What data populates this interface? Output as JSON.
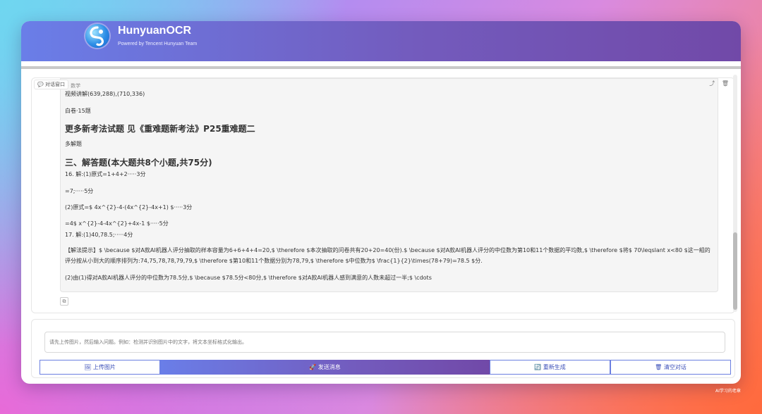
{
  "app": {
    "title": "HunyuanOCR",
    "subtitle": "Powered by Tencent Hunyuan Team"
  },
  "chat": {
    "label": "💬 对话窗口",
    "share_icon": "share-icon",
    "delete_icon": "trash-icon",
    "lines": [
      "视频讲解(639,288),(710,336)",
      "白卷·15题",
      "更多新考法试题 见《重难题新考法》P25重难题二",
      "多解题",
      "三、解答题(本大题共8个小题,共75分)",
      "16. 解:(1)原式=1+4+2·····3分",
      "=7;·····5分",
      "(2)原式=$ 4x^{2}-4-(4x^{2}-4x+1) $·····3分",
      "=4$ x^{2}-4-4x^{2}+4x-1 $·····5分",
      "17. 解:(1)40,78.5;·····4分",
      "【解法提示】$ \\because $对A款AI机器人评分抽取的样本容量为6+6+4+4=20,$ \\therefore $本次抽取的问卷共有20+20=40(份).$ \\because $对A款AI机器人评分的中位数为第10和11个数据的平均数,$ \\therefore $将$ 70\\leqslant x<80 $这一組的评分按从小到大的顺序排列为:74,75,78,78,79,79,$ \\therefore $第10和11个数据分别为78,79,$ \\therefore $中位数为$ \\frac{1}{2}\\times(78+79)=78.5 $分.",
      "(2)由(1)得对A款AI机器人评分的中位数为78.5分,$ \\because $78.5分<80分,$ \\therefore $对A款AI机器人感到满意的人数未超过一半;$ \\cdots"
    ]
  },
  "input": {
    "placeholder": "请先上传图片，然后输入问题。例如：检测并识别图片中的文字，将文本坐标格式化输出。"
  },
  "buttons": {
    "upload": "🖼 上传图片",
    "send": "🚀 发送消息",
    "regenerate": "🔄 重新生成",
    "clear": "🗑 清空对话"
  },
  "watermark": "AI学习的老章",
  "colors": {
    "header_start": "#6a7ee8",
    "header_end": "#7149a8",
    "button_border": "#6b7fe0"
  }
}
